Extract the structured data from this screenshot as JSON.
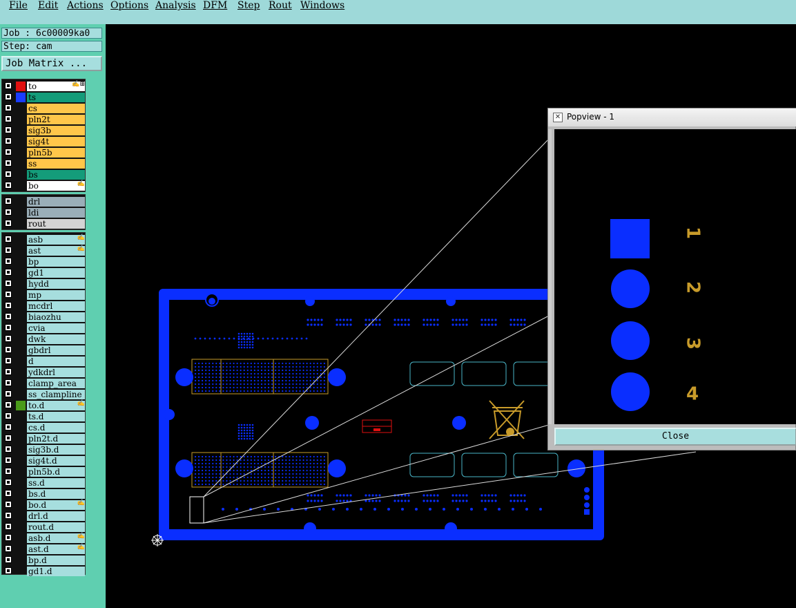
{
  "menu": {
    "items": [
      "File",
      "Edit",
      "Actions",
      "Options",
      "Analysis",
      "DFM",
      "Step",
      "Rout",
      "Windows"
    ]
  },
  "info": {
    "job": "Job : 6c00009ka0",
    "step": "Step: cam",
    "job_matrix": "Job Matrix ..."
  },
  "colors": {
    "panel": "#5fcfb0",
    "board_blue": "#0a2eff",
    "copper_yellow": "#ffc64a",
    "gold": "#c89b2a",
    "silk_red": "#e01010",
    "layer_green": "#149c7a",
    "outline_cyan": "#4ab6c8"
  },
  "layers_board": [
    {
      "name": "to",
      "color": "#ffffff",
      "swatch": "#e01010",
      "flag": "✍⊞"
    },
    {
      "name": "ts",
      "color": "#149c7a",
      "swatch": "#1a3cff",
      "flag": ""
    },
    {
      "name": "cs",
      "color": "#ffc64a",
      "swatch": "",
      "flag": ""
    },
    {
      "name": "pln2t",
      "color": "#ffc64a",
      "swatch": "",
      "flag": ""
    },
    {
      "name": "sig3b",
      "color": "#ffc64a",
      "swatch": "",
      "flag": ""
    },
    {
      "name": "sig4t",
      "color": "#ffc64a",
      "swatch": "",
      "flag": ""
    },
    {
      "name": "pln5b",
      "color": "#ffc64a",
      "swatch": "",
      "flag": ""
    },
    {
      "name": "ss",
      "color": "#ffc64a",
      "swatch": "",
      "flag": ""
    },
    {
      "name": "bs",
      "color": "#149c7a",
      "swatch": "",
      "flag": ""
    },
    {
      "name": "bo",
      "color": "#ffffff",
      "swatch": "",
      "flag": "✍"
    }
  ],
  "layers_drill": [
    {
      "name": "drl",
      "color": "#9aaeb8",
      "swatch": "",
      "flag": ""
    },
    {
      "name": "ldi",
      "color": "#9aaeb8",
      "swatch": "",
      "flag": ""
    },
    {
      "name": "rout",
      "color": "#d4d4d4",
      "swatch": "",
      "flag": ""
    }
  ],
  "layers_misc": [
    {
      "name": "asb",
      "color": "#a6dede",
      "swatch": "",
      "flag": "✍"
    },
    {
      "name": "ast",
      "color": "#a6dede",
      "swatch": "",
      "flag": "✍"
    },
    {
      "name": "bp",
      "color": "#a6dede",
      "swatch": "",
      "flag": ""
    },
    {
      "name": "gd1",
      "color": "#a6dede",
      "swatch": "",
      "flag": ""
    },
    {
      "name": "hydd",
      "color": "#a6dede",
      "swatch": "",
      "flag": ""
    },
    {
      "name": "mp",
      "color": "#a6dede",
      "swatch": "",
      "flag": ""
    },
    {
      "name": "mcdrl",
      "color": "#a6dede",
      "swatch": "",
      "flag": ""
    },
    {
      "name": "biaozhu",
      "color": "#a6dede",
      "swatch": "",
      "flag": ""
    },
    {
      "name": "cvia",
      "color": "#a6dede",
      "swatch": "",
      "flag": ""
    },
    {
      "name": "dwk",
      "color": "#a6dede",
      "swatch": "",
      "flag": ""
    },
    {
      "name": "gbdrl",
      "color": "#a6dede",
      "swatch": "",
      "flag": ""
    },
    {
      "name": "d",
      "color": "#a6dede",
      "swatch": "",
      "flag": ""
    },
    {
      "name": "ydkdrl",
      "color": "#a6dede",
      "swatch": "",
      "flag": ""
    },
    {
      "name": "clamp_area",
      "color": "#a6dede",
      "swatch": "",
      "flag": ""
    },
    {
      "name": "ss_clampline",
      "color": "#a6dede",
      "swatch": "",
      "flag": ""
    },
    {
      "name": "to.d",
      "color": "#a6dede",
      "swatch": "#4a9a1a",
      "flag": "✍"
    },
    {
      "name": "ts.d",
      "color": "#a6dede",
      "swatch": "",
      "flag": ""
    },
    {
      "name": "cs.d",
      "color": "#a6dede",
      "swatch": "",
      "flag": ""
    },
    {
      "name": "pln2t.d",
      "color": "#a6dede",
      "swatch": "",
      "flag": ""
    },
    {
      "name": "sig3b.d",
      "color": "#a6dede",
      "swatch": "",
      "flag": ""
    },
    {
      "name": "sig4t.d",
      "color": "#a6dede",
      "swatch": "",
      "flag": ""
    },
    {
      "name": "pln5b.d",
      "color": "#a6dede",
      "swatch": "",
      "flag": ""
    },
    {
      "name": "ss.d",
      "color": "#a6dede",
      "swatch": "",
      "flag": ""
    },
    {
      "name": "bs.d",
      "color": "#a6dede",
      "swatch": "",
      "flag": ""
    },
    {
      "name": "bo.d",
      "color": "#a6dede",
      "swatch": "",
      "flag": "✍"
    },
    {
      "name": "drl.d",
      "color": "#a6dede",
      "swatch": "",
      "flag": ""
    },
    {
      "name": "rout.d",
      "color": "#a6dede",
      "swatch": "",
      "flag": ""
    },
    {
      "name": "asb.d",
      "color": "#a6dede",
      "swatch": "",
      "flag": "✍"
    },
    {
      "name": "ast.d",
      "color": "#a6dede",
      "swatch": "",
      "flag": "✍"
    },
    {
      "name": "bp.d",
      "color": "#a6dede",
      "swatch": "",
      "flag": ""
    },
    {
      "name": "gd1.d",
      "color": "#a6dede",
      "swatch": "",
      "flag": ""
    }
  ],
  "popview": {
    "title": "Popview - 1",
    "close_label": "Close",
    "pin_labels": [
      "1",
      "2",
      "3",
      "4"
    ]
  }
}
